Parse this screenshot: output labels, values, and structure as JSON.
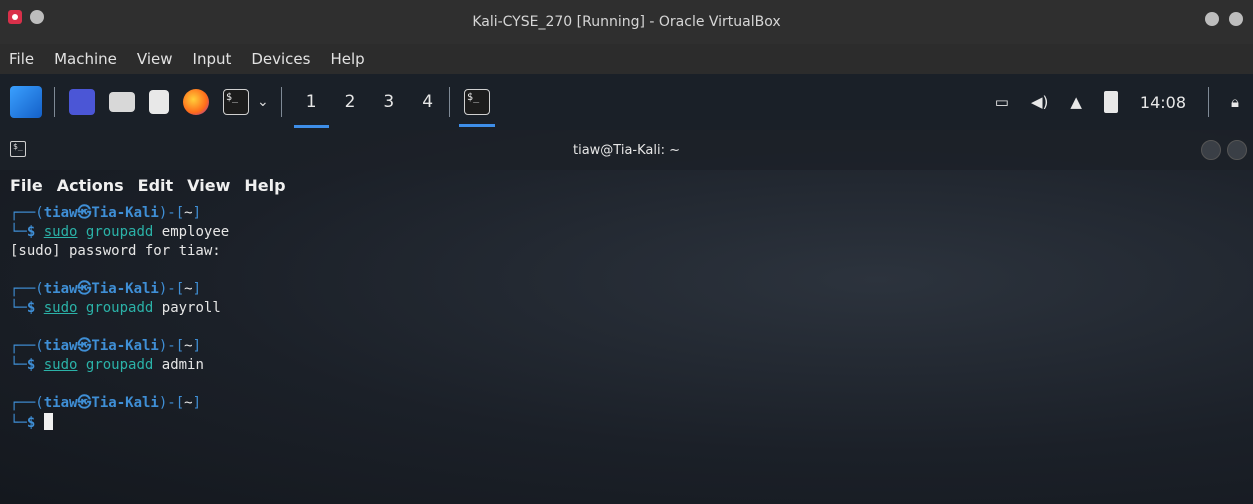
{
  "vbox": {
    "title": "Kali-CYSE_270 [Running] - Oracle VirtualBox",
    "menu": [
      "File",
      "Machine",
      "View",
      "Input",
      "Devices",
      "Help"
    ]
  },
  "panel": {
    "workspaces": [
      "1",
      "2",
      "3",
      "4"
    ],
    "active_workspace": "1",
    "clock": "14:08",
    "term_glyph": "$_",
    "chevron": "⌄",
    "icons": [
      "kali-dragon-icon",
      "workspace-square-icon",
      "file-manager-icon",
      "text-editor-icon",
      "firefox-icon",
      "terminal-icon",
      "chevron-down-icon",
      "terminal-task-icon",
      "display-icon",
      "volume-icon",
      "bell-icon",
      "battery-icon",
      "lock-icon"
    ]
  },
  "terminal": {
    "title": "tiaw@Tia-Kali: ~",
    "menu": [
      "File",
      "Actions",
      "Edit",
      "View",
      "Help"
    ],
    "prompt_user": "tiaw㉿Tia-Kali",
    "prompt_open": "┌──(",
    "prompt_mid": ")-[",
    "prompt_dir": "~",
    "prompt_close": "]",
    "prompt_corner": "└─",
    "dollar": "$",
    "commands": [
      {
        "sudo": "sudo",
        "cmd": "groupadd",
        "arg": "employee",
        "output": "[sudo] password for tiaw:"
      },
      {
        "sudo": "sudo",
        "cmd": "groupadd",
        "arg": "payroll",
        "output": ""
      },
      {
        "sudo": "sudo",
        "cmd": "groupadd",
        "arg": "admin",
        "output": ""
      }
    ]
  },
  "colors": {
    "prompt_blue": "#3f8fd6",
    "command_teal": "#2bb2a8",
    "accent_blue": "#3e8ee8"
  }
}
